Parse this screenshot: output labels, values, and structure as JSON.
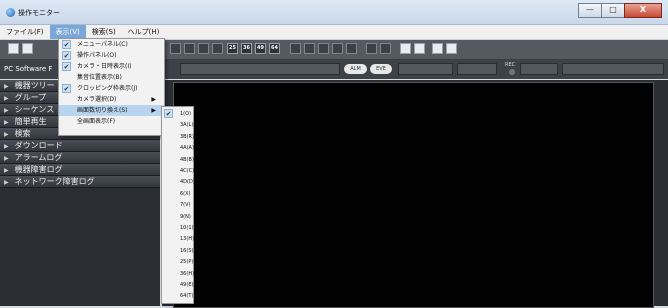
{
  "window": {
    "title": "操作モニター",
    "buttons": [
      "—",
      "□",
      "X"
    ]
  },
  "menubar": [
    "ファイル(F)",
    "表示(V)",
    "検索(S)",
    "ヘルプ(H)"
  ],
  "toolbar": {
    "layout_buttons": [
      "25",
      "36",
      "49",
      "64"
    ]
  },
  "infobar": {
    "software": "PC Software F",
    "suffix": "S",
    "alarm_label": "ALM",
    "event_label": "EVE",
    "rec_label": "REC"
  },
  "sidebar": [
    "機器ツリー",
    "グループ",
    "シーケンス",
    "簡単再生",
    "検索",
    "ダウンロード",
    "アラームログ",
    "機器障害ログ",
    "ネットワーク障害ログ"
  ],
  "view_menu": [
    {
      "label": "メニューパネル(C)",
      "checked": true
    },
    {
      "label": "操作パネル(O)",
      "checked": true
    },
    {
      "label": "カメラ・日時表示(I)",
      "checked": true
    },
    {
      "label": "集音位置表示(B)",
      "checked": false
    },
    {
      "label": "クロッピング枠表示(J)",
      "checked": true
    },
    {
      "label": "カメラ選択(D)",
      "checked": false,
      "submenu": true
    },
    {
      "label": "画面数切り換え(S)",
      "checked": false,
      "submenu": true,
      "highlighted": true
    },
    {
      "label": "全画面表示(F)",
      "checked": false
    }
  ],
  "screen_menu": [
    "1(O)",
    "3A(L)",
    "3B(R)",
    "4A(A)",
    "4B(B)",
    "4C(C)",
    "4D(D)",
    "6(X)",
    "7(V)",
    "9(N)",
    "10(1)",
    "13(H)",
    "16(S)",
    "25(P)",
    "36(H)",
    "49(E)",
    "64(T)"
  ],
  "screen_menu_checked": "1(O)"
}
